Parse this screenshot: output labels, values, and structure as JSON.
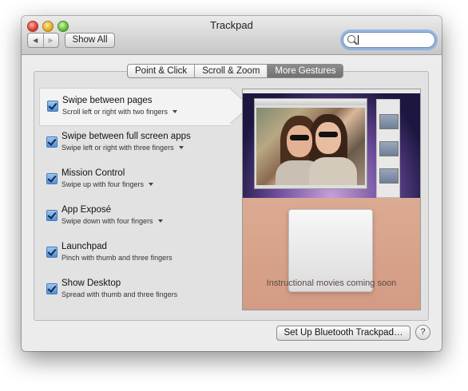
{
  "window": {
    "title": "Trackpad"
  },
  "toolbar": {
    "back_glyph": "◀",
    "forward_glyph": "▶",
    "show_all": "Show All"
  },
  "search": {
    "value": "",
    "placeholder": ""
  },
  "tabs": [
    {
      "label": "Point & Click",
      "active": false
    },
    {
      "label": "Scroll & Zoom",
      "active": false
    },
    {
      "label": "More Gestures",
      "active": true
    }
  ],
  "gestures": [
    {
      "title": "Swipe between pages",
      "description": "Scroll left or right with two fingers",
      "checked": true,
      "has_menu": true,
      "selected": true
    },
    {
      "title": "Swipe between full screen apps",
      "description": "Swipe left or right with three fingers",
      "checked": true,
      "has_menu": true
    },
    {
      "title": "Mission Control",
      "description": "Swipe up with four fingers",
      "checked": true,
      "has_menu": true
    },
    {
      "title": "App Exposé",
      "description": "Swipe down with four fingers",
      "checked": true,
      "has_menu": true
    },
    {
      "title": "Launchpad",
      "description": "Pinch with thumb and three fingers",
      "checked": true,
      "has_menu": false
    },
    {
      "title": "Show Desktop",
      "description": "Spread with thumb and three fingers",
      "checked": true,
      "has_menu": false
    }
  ],
  "preview": {
    "caption": "Instructional movies coming soon"
  },
  "footer": {
    "bluetooth_button": "Set Up Bluetooth Trackpad…",
    "help_glyph": "?"
  },
  "colors": {
    "checkbox": "#4f8fd9",
    "active_tab": "#7a7a7a",
    "search_focus": "#69a0e6"
  }
}
